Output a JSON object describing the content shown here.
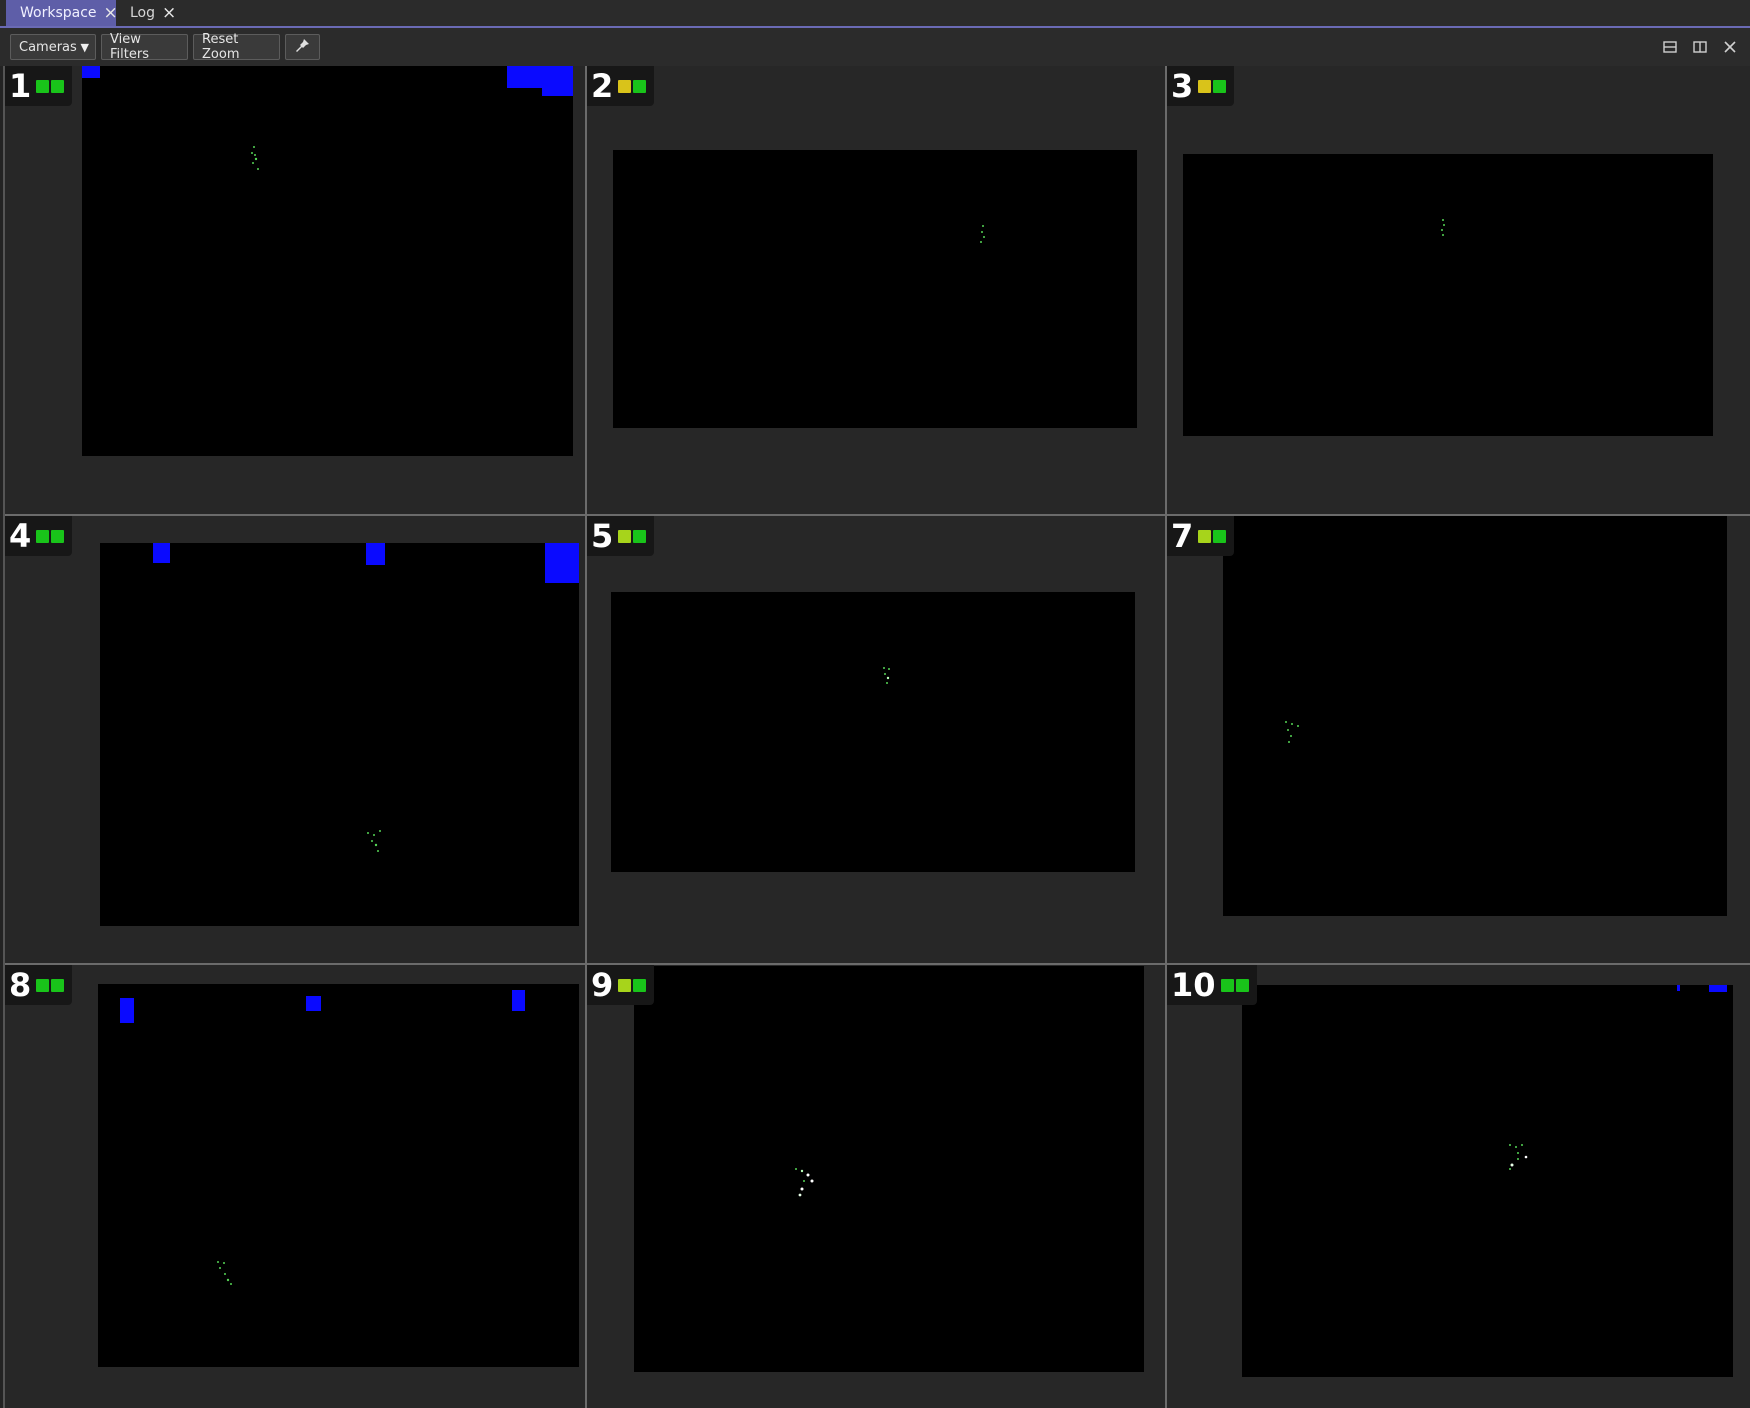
{
  "tabs": [
    {
      "label": "Workspace",
      "active": true
    },
    {
      "label": "Log",
      "active": false
    }
  ],
  "toolbar": {
    "cameras_label": "Cameras",
    "view_filters_label": "View Filters",
    "reset_zoom_label": "Reset Zoom",
    "pin_icon": "pin-icon"
  },
  "window_controls": [
    "split-horizontal-icon",
    "split-vertical-icon",
    "close-icon"
  ],
  "colors": {
    "status_green": "#19c41a",
    "status_yellow": "#d9c31a",
    "status_yellowgreen": "#a7d41b",
    "blob_blue": "#0a0aff",
    "marker_green": "#55d455",
    "tab_active": "#5e5ea8"
  },
  "cameras": [
    {
      "number": "1",
      "led1": "green",
      "led2": "green"
    },
    {
      "number": "2",
      "led1": "yellow",
      "led2": "green"
    },
    {
      "number": "3",
      "led1": "yellow",
      "led2": "green"
    },
    {
      "number": "4",
      "led1": "green",
      "led2": "green"
    },
    {
      "number": "5",
      "led1": "yellowgreen",
      "led2": "green"
    },
    {
      "number": "7",
      "led1": "yellowgreen",
      "led2": "green"
    },
    {
      "number": "8",
      "led1": "green",
      "led2": "green"
    },
    {
      "number": "9",
      "led1": "yellowgreen",
      "led2": "green"
    },
    {
      "number": "10",
      "led1": "green",
      "led2": "green"
    }
  ]
}
